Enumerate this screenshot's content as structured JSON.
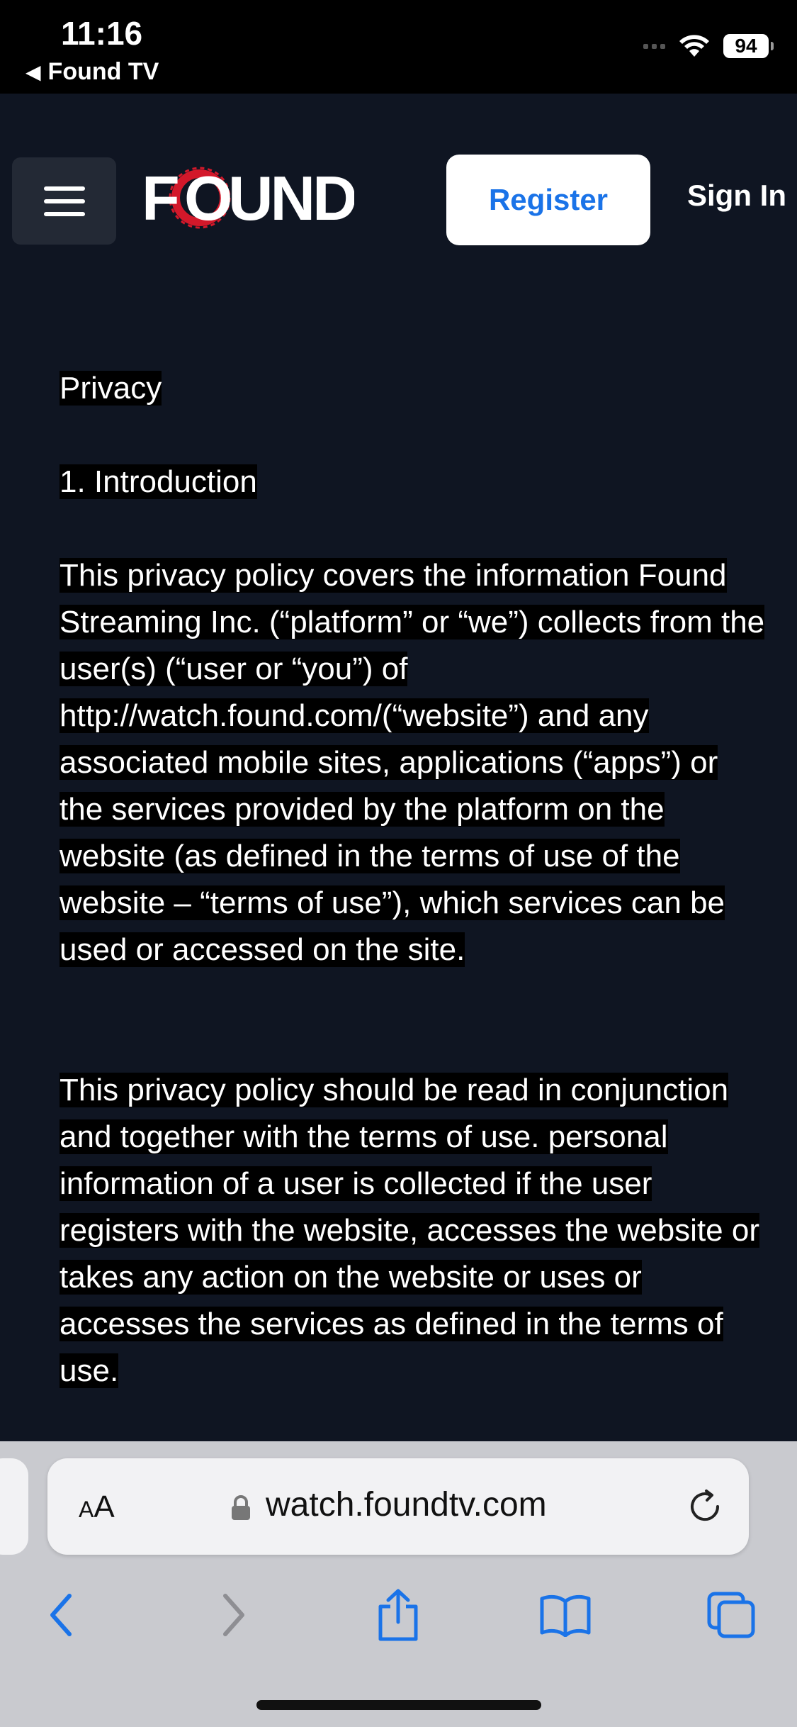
{
  "status_bar": {
    "time": "11:16",
    "back_label": "Found TV",
    "battery": "94"
  },
  "header": {
    "logo_text": "FOUND",
    "register_label": "Register",
    "signin_label": "Sign In"
  },
  "content": {
    "title": "Privacy",
    "section_heading": "1. Introduction",
    "paragraph1": "This privacy policy covers the information Found Streaming Inc. (“platform” or “we”) collects from the user(s) (“user or “you”) of http://watch.found.com/(“website”) and any associated mobile sites, applications (“apps”) or the services provided by the platform on the website (as defined in the terms of use of the website – “terms of use”), which services can be used or accessed on the site.",
    "paragraph2": "This privacy policy should be read in conjunction and together with the terms of use. personal information of a user is collected if the user registers with the website, accesses the website or takes any action on the website or uses or accesses the services as defined in the terms of use."
  },
  "browser": {
    "aa_label": "AA",
    "url": "watch.foundtv.com"
  },
  "colors": {
    "page_bg": "#0f1522",
    "accent": "#1a73e8",
    "logo_red": "#d3182a"
  }
}
